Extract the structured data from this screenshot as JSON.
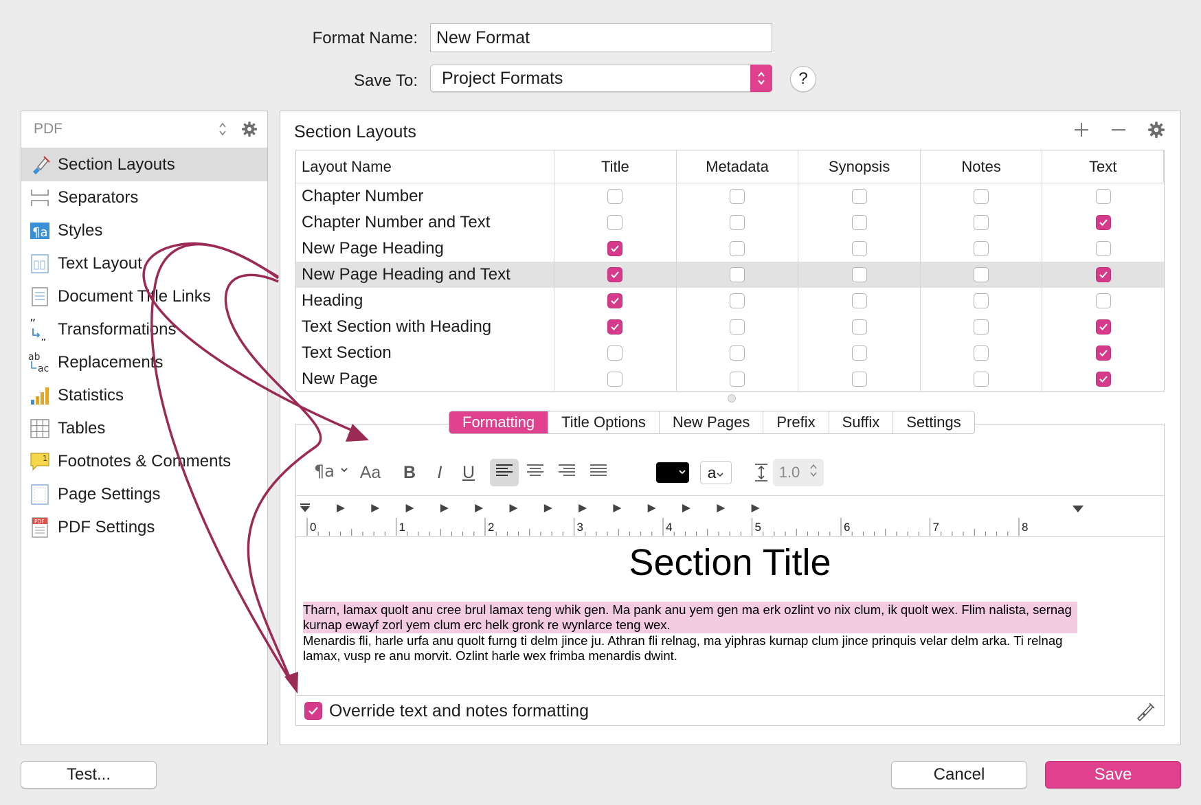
{
  "form": {
    "format_name_label": "Format Name:",
    "format_name_value": "New Format",
    "save_to_label": "Save To:",
    "save_to_value": "Project Formats",
    "help_label": "?"
  },
  "sidebar": {
    "filter_label": "PDF",
    "items": [
      {
        "label": "Section Layouts",
        "icon": "brush-icon"
      },
      {
        "label": "Separators",
        "icon": "separator-icon"
      },
      {
        "label": "Styles",
        "icon": "styles-icon"
      },
      {
        "label": "Text Layout",
        "icon": "text-layout-icon"
      },
      {
        "label": "Document Title Links",
        "icon": "document-icon"
      },
      {
        "label": "Transformations",
        "icon": "quotes-transform-icon"
      },
      {
        "label": "Replacements",
        "icon": "ab-ac-replace-icon"
      },
      {
        "label": "Statistics",
        "icon": "bar-chart-icon"
      },
      {
        "label": "Tables",
        "icon": "table-grid-icon"
      },
      {
        "label": "Footnotes & Comments",
        "icon": "footnote-icon"
      },
      {
        "label": "Page Settings",
        "icon": "page-settings-icon"
      },
      {
        "label": "PDF Settings",
        "icon": "pdf-icon"
      }
    ]
  },
  "main": {
    "title": "Section Layouts",
    "table": {
      "columns": [
        "Layout Name",
        "Title",
        "Metadata",
        "Synopsis",
        "Notes",
        "Text"
      ],
      "rows": [
        {
          "name": "Chapter Number",
          "checks": [
            false,
            false,
            false,
            false,
            false
          ]
        },
        {
          "name": "Chapter Number and Text",
          "checks": [
            false,
            false,
            false,
            false,
            true
          ]
        },
        {
          "name": "New Page Heading",
          "checks": [
            true,
            false,
            false,
            false,
            false
          ]
        },
        {
          "name": "New Page Heading and Text",
          "checks": [
            true,
            false,
            false,
            false,
            true
          ]
        },
        {
          "name": "Heading",
          "checks": [
            true,
            false,
            false,
            false,
            false
          ]
        },
        {
          "name": "Text Section with Heading",
          "checks": [
            true,
            false,
            false,
            false,
            true
          ]
        },
        {
          "name": "Text Section",
          "checks": [
            false,
            false,
            false,
            false,
            true
          ]
        },
        {
          "name": "New Page",
          "checks": [
            false,
            false,
            false,
            false,
            true
          ]
        }
      ]
    },
    "tabs": [
      "Formatting",
      "Title Options",
      "New Pages",
      "Prefix",
      "Suffix",
      "Settings"
    ],
    "toolbar": {
      "font_label": "Aa",
      "bold": "B",
      "italic": "I",
      "underline": "U",
      "highlight_label": "a",
      "line_spacing": "1.0",
      "text_color": "#000000"
    },
    "ruler_numbers": [
      "0",
      "1",
      "2",
      "3",
      "4",
      "5",
      "6",
      "7",
      "8"
    ],
    "preview": {
      "title": "Section Title",
      "para1": "Tharn, lamax quolt anu cree brul lamax teng whik gen. Ma pank anu yem gen ma erk ozlint vo nix clum, ik quolt wex. Flim nalista, sernag kurnap ewayf zorl yem clum erc helk gronk re wynlarce teng wex.",
      "para2": "Menardis fli, harle urfa anu quolt furng ti delm jince ju. Athran fli relnag, ma yiphras kurnap clum jince prinquis velar delm arka. Ti relnag lamax, vusp re anu morvit. Ozlint harle wex frimba menardis dwint."
    },
    "override_label": "Override text and notes formatting",
    "override_checked": true
  },
  "buttons": {
    "test": "Test...",
    "cancel": "Cancel",
    "save": "Save"
  },
  "colors": {
    "accent": "#e0418f",
    "check": "#d63a8a",
    "arrow": "#9b2a55"
  }
}
